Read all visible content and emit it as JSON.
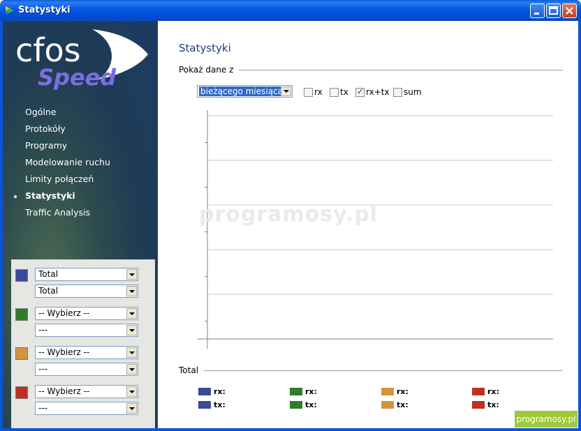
{
  "window": {
    "title": "Statystyki",
    "icon": "cfos-app-icon",
    "controls": [
      "minimize-icon",
      "maximize-icon",
      "close-icon"
    ]
  },
  "logo": {
    "line1": "cfos",
    "line2": "Speed"
  },
  "nav": {
    "items": [
      {
        "label": "Ogólne",
        "active": false
      },
      {
        "label": "Protokóły",
        "active": false
      },
      {
        "label": "Programy",
        "active": false
      },
      {
        "label": "Modelowanie ruchu",
        "active": false
      },
      {
        "label": "Limity połączeń",
        "active": false
      },
      {
        "label": "Statystyki",
        "active": true
      },
      {
        "label": "Traffic Analysis",
        "active": false
      }
    ]
  },
  "series_selectors": [
    {
      "color": "#3a4a96",
      "primary": "Total",
      "secondary": "Total"
    },
    {
      "color": "#2e7d2a",
      "primary": "-- Wybierz --",
      "secondary": "---"
    },
    {
      "color": "#d3943e",
      "primary": "-- Wybierz --",
      "secondary": "---"
    },
    {
      "color": "#c0301f",
      "primary": "-- Wybierz --",
      "secondary": "---"
    }
  ],
  "main": {
    "title": "Statystyki",
    "show_data_label": "Pokaż dane z",
    "period": "bieżącego miesiąca",
    "checkboxes": [
      {
        "label": "rx",
        "checked": false
      },
      {
        "label": "tx",
        "checked": false
      },
      {
        "label": "rx+tx",
        "checked": true
      },
      {
        "label": "sum",
        "checked": false
      }
    ],
    "total_label": "Total",
    "legend": [
      {
        "color": "#3a4a96",
        "rx": "rx:",
        "tx": "tx:"
      },
      {
        "color": "#2e7d2a",
        "rx": "rx:",
        "tx": "tx:"
      },
      {
        "color": "#d3943e",
        "rx": "rx:",
        "tx": "tx:"
      },
      {
        "color": "#c0301f",
        "rx": "rx:",
        "tx": "tx:"
      }
    ]
  },
  "chart_data": {
    "type": "line",
    "series": [],
    "grid": true,
    "gridlines": 5
  },
  "watermark": "programosy.pl",
  "badge": "programosy.pl"
}
